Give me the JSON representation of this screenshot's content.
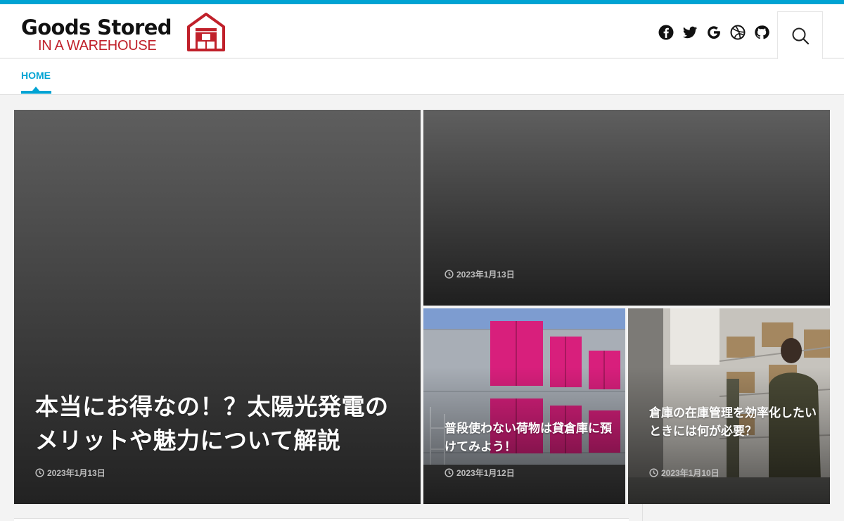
{
  "brand": {
    "title": "Goods Stored",
    "subtitle": "IN A WAREHOUSE",
    "accent_color": "#00a3d3",
    "logo_red": "#c0202a"
  },
  "header": {
    "social_icons": [
      "facebook-icon",
      "twitter-icon",
      "google-icon",
      "dribbble-icon",
      "github-icon"
    ],
    "search_icon": "search-icon"
  },
  "nav": {
    "items": [
      {
        "label": "HOME",
        "active": true
      }
    ]
  },
  "posts": [
    {
      "title": "本当にお得なの！？太陽光発電のメリットや魅力について解説",
      "date": "2023年1月13日"
    },
    {
      "title": "",
      "date": "2023年1月13日"
    },
    {
      "title": "普段使わない荷物は貸倉庫に預けてみよう！",
      "date": "2023年1月12日"
    },
    {
      "title": "倉庫の在庫管理を効率化したいときには何が必要？",
      "date": "2023年1月10日"
    }
  ]
}
